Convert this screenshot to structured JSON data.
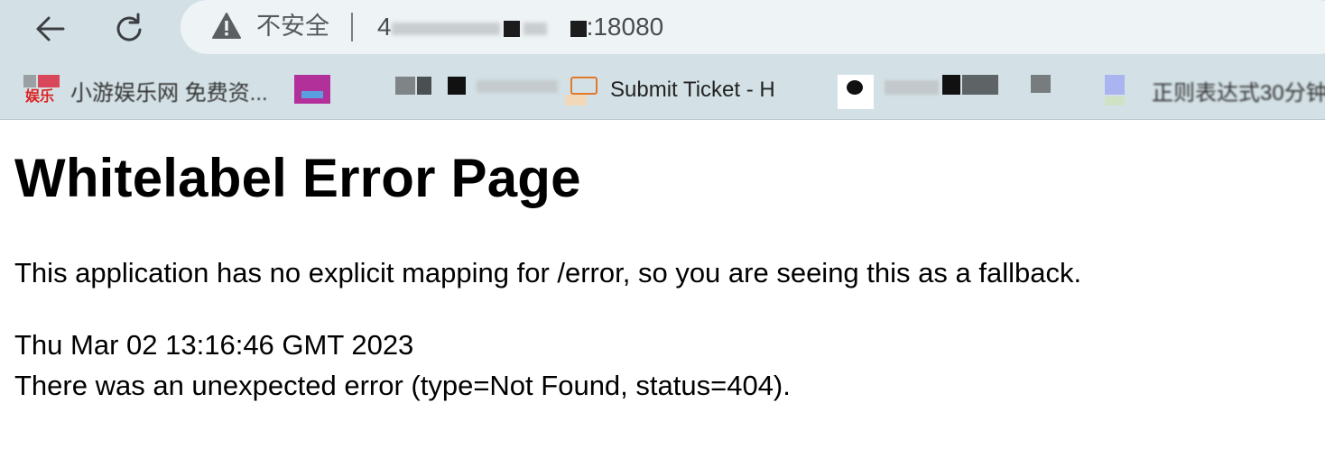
{
  "browser": {
    "security_label": "不安全",
    "url_visible_suffix": ":18080",
    "url_partial_prefix": "4",
    "icons": {
      "back": "arrow-left-icon",
      "reload": "reload-icon",
      "warning": "warning-triangle-icon"
    }
  },
  "bookmarks": [
    {
      "label": "小游娱乐网 免费资...",
      "icon_text": "娱乐"
    },
    {
      "label": ""
    },
    {
      "label": "Submit Ticket - H"
    },
    {
      "label": ""
    },
    {
      "label": "正则表达式30分钟..."
    }
  ],
  "page": {
    "title": "Whitelabel Error Page",
    "message": "This application has no explicit mapping for /error, so you are seeing this as a fallback.",
    "timestamp": "Thu Mar 02 13:16:46 GMT 2023",
    "error_detail": "There was an unexpected error (type=Not Found, status=404)."
  }
}
